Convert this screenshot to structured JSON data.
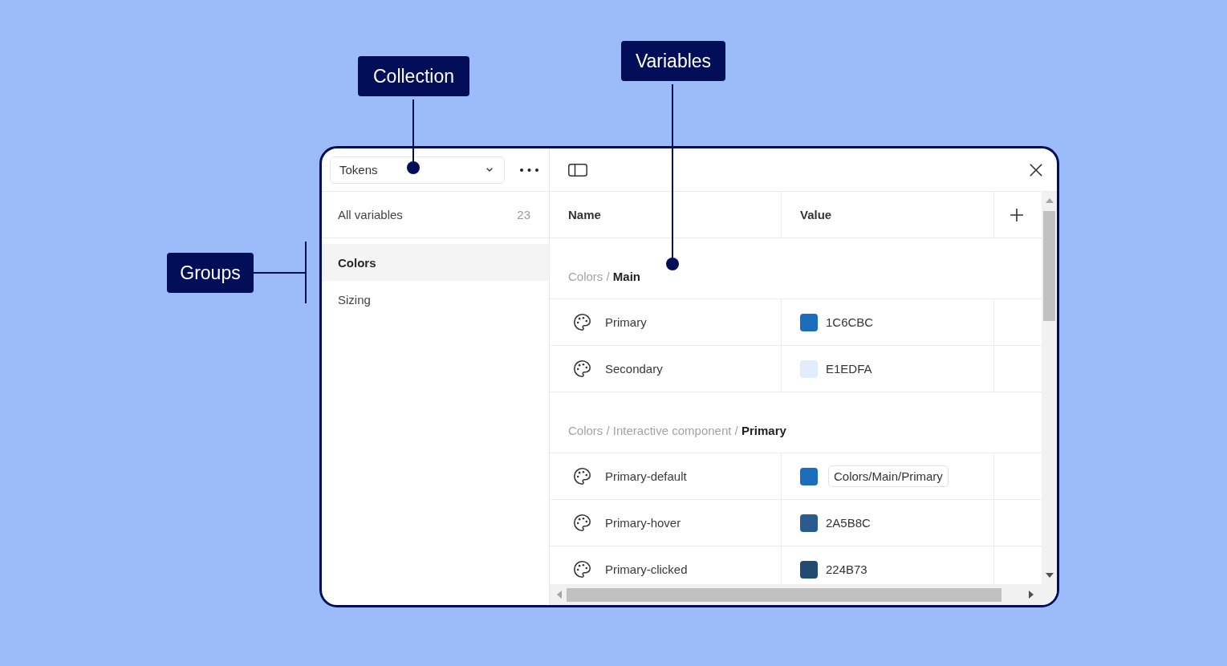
{
  "callouts": [
    {
      "label": "Collection",
      "kind": "dot"
    },
    {
      "label": "Variables",
      "kind": "dot"
    },
    {
      "label": "Groups",
      "kind": "bracket"
    }
  ],
  "sidebar": {
    "collection": "Tokens",
    "all_variables": {
      "label": "All variables",
      "count": "23"
    },
    "groups": [
      {
        "label": "Colors",
        "selected": true
      },
      {
        "label": "Sizing",
        "selected": false
      }
    ]
  },
  "table": {
    "columns": [
      "Name",
      "Value"
    ],
    "sections": [
      {
        "heading": "Colors / **Main**",
        "rows": [
          {
            "name": "Primary",
            "kind": "hex",
            "color": "#1c6cbc",
            "value": "1C6CBC"
          },
          {
            "name": "Secondary",
            "kind": "hex",
            "color": "#e1edfa",
            "value": "E1EDFA"
          }
        ]
      },
      {
        "heading": "Colors / Interactive component / **Primary**",
        "rows": [
          {
            "name": "Primary-default",
            "kind": "alias",
            "color": "#1c6cbc",
            "value": "Colors/Main/Primary"
          },
          {
            "name": "Primary-hover",
            "kind": "hex",
            "color": "#2a5b8c",
            "value": "2A5B8C"
          },
          {
            "name": "Primary-clicked",
            "kind": "hex",
            "color": "#224b73",
            "value": "224B73"
          }
        ]
      }
    ]
  }
}
